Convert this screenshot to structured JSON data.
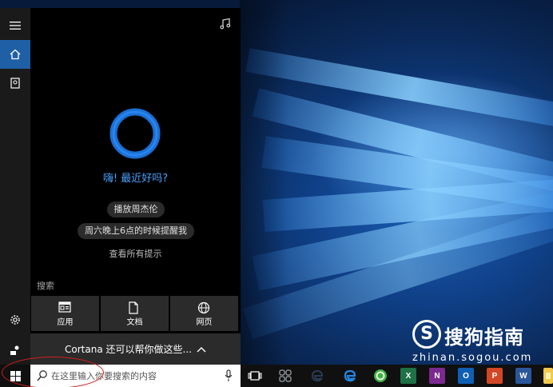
{
  "panel": {
    "greeting": "嗨! 最近好吗?",
    "suggestions": [
      "播放周杰伦",
      "周六晚上6点的时候提醒我"
    ],
    "all_tips": "查看所有提示",
    "search_label": "搜索",
    "tiles": [
      {
        "label": "应用",
        "icon": "app-window-icon"
      },
      {
        "label": "文档",
        "icon": "document-icon"
      },
      {
        "label": "网页",
        "icon": "globe-icon"
      }
    ],
    "more": "Cortana 还可以帮你做这些...",
    "more_icon": "chevron-up-icon"
  },
  "taskbar": {
    "search_placeholder": "在这里输入你要搜索的内容",
    "apps": [
      {
        "name": "task-view-icon"
      },
      {
        "name": "store-app-icon"
      },
      {
        "name": "edge-icon"
      },
      {
        "name": "ie-icon"
      },
      {
        "name": "360-browser-icon"
      },
      {
        "name": "excel-icon",
        "letter": "X",
        "color": "#1e7145"
      },
      {
        "name": "onenote-icon",
        "letter": "N",
        "color": "#7b2a90"
      },
      {
        "name": "outlook-icon",
        "letter": "O",
        "color": "#0f5fb5"
      },
      {
        "name": "powerpoint-icon",
        "letter": "P",
        "color": "#d24726"
      },
      {
        "name": "word-icon",
        "letter": "W",
        "color": "#2b579a"
      },
      {
        "name": "sticky-notes-icon"
      }
    ]
  },
  "watermark": {
    "logo": "S",
    "title": "搜狗指南",
    "url": "zhinan.sogou.com"
  },
  "colors": {
    "accent": "#4aa3ff",
    "rail_active": "#1f5fa5",
    "annotation": "#d21d1d"
  }
}
